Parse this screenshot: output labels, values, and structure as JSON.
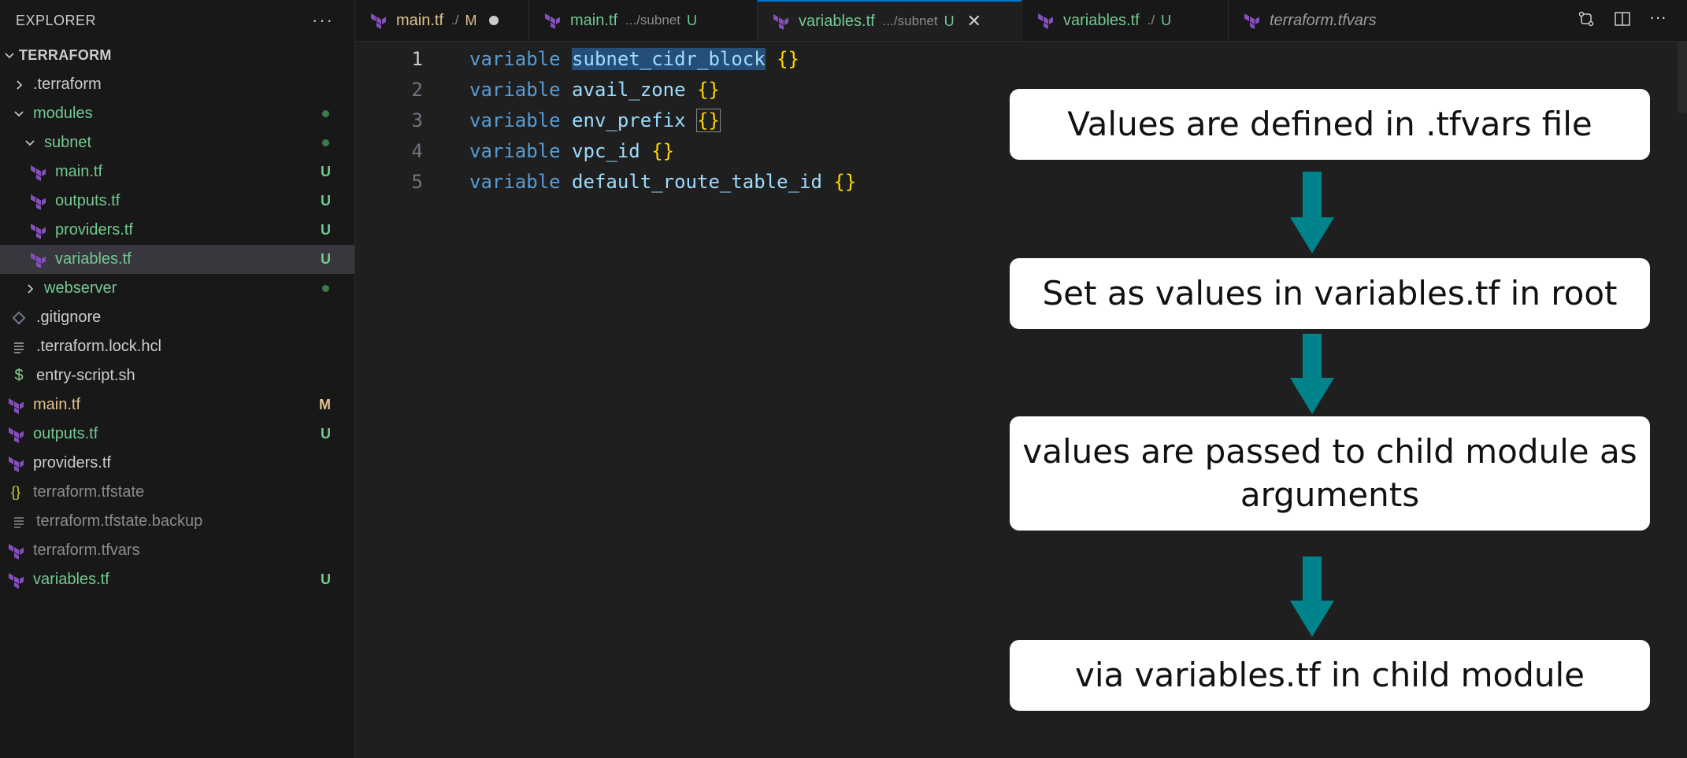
{
  "sidebar": {
    "title": "EXPLORER",
    "more": "···",
    "root": "TERRAFORM",
    "items": [
      {
        "label": ".terraform",
        "status": ""
      },
      {
        "label": "modules",
        "status": "dot"
      },
      {
        "label": "subnet",
        "status": "dot"
      },
      {
        "label": "main.tf",
        "status": "U"
      },
      {
        "label": "outputs.tf",
        "status": "U"
      },
      {
        "label": "providers.tf",
        "status": "U"
      },
      {
        "label": "variables.tf",
        "status": "U"
      },
      {
        "label": "webserver",
        "status": "dot"
      },
      {
        "label": ".gitignore",
        "status": ""
      },
      {
        "label": ".terraform.lock.hcl",
        "status": ""
      },
      {
        "label": "entry-script.sh",
        "status": ""
      },
      {
        "label": "main.tf",
        "status": "M"
      },
      {
        "label": "outputs.tf",
        "status": "U"
      },
      {
        "label": "providers.tf",
        "status": ""
      },
      {
        "label": "terraform.tfstate",
        "status": ""
      },
      {
        "label": "terraform.tfstate.backup",
        "status": ""
      },
      {
        "label": "terraform.tfvars",
        "status": ""
      },
      {
        "label": "variables.tf",
        "status": "U"
      }
    ]
  },
  "tabs": [
    {
      "name": "main.tf",
      "desc": "./",
      "badge": "M"
    },
    {
      "name": "main.tf",
      "desc": ".../subnet",
      "badge": "U"
    },
    {
      "name": "variables.tf",
      "desc": ".../subnet",
      "badge": "U"
    },
    {
      "name": "variables.tf",
      "desc": "./",
      "badge": "U"
    },
    {
      "name": "terraform.tfvars",
      "desc": "",
      "badge": ""
    }
  ],
  "editor": {
    "lines": [
      {
        "num": "1",
        "kw": "variable",
        "name": "subnet_cidr_block",
        "braces": "{}"
      },
      {
        "num": "2",
        "kw": "variable",
        "name": "avail_zone",
        "braces": "{}"
      },
      {
        "num": "3",
        "kw": "variable",
        "name": "env_prefix",
        "braces": "{}"
      },
      {
        "num": "4",
        "kw": "variable",
        "name": "vpc_id",
        "braces": "{}"
      },
      {
        "num": "5",
        "kw": "variable",
        "name": "default_route_table_id",
        "braces": "{}"
      }
    ]
  },
  "flow": {
    "steps": [
      "Values are defined in .tfvars file",
      "Set as values in variables.tf in root",
      "values are passed to child module as arguments",
      "via variables.tf in child module"
    ],
    "arrow_color": "#00838a"
  },
  "colors": {
    "accent": "#0078d4",
    "terraform_icon": "#844fba",
    "untracked": "#73c991",
    "modified": "#e2c08d"
  }
}
